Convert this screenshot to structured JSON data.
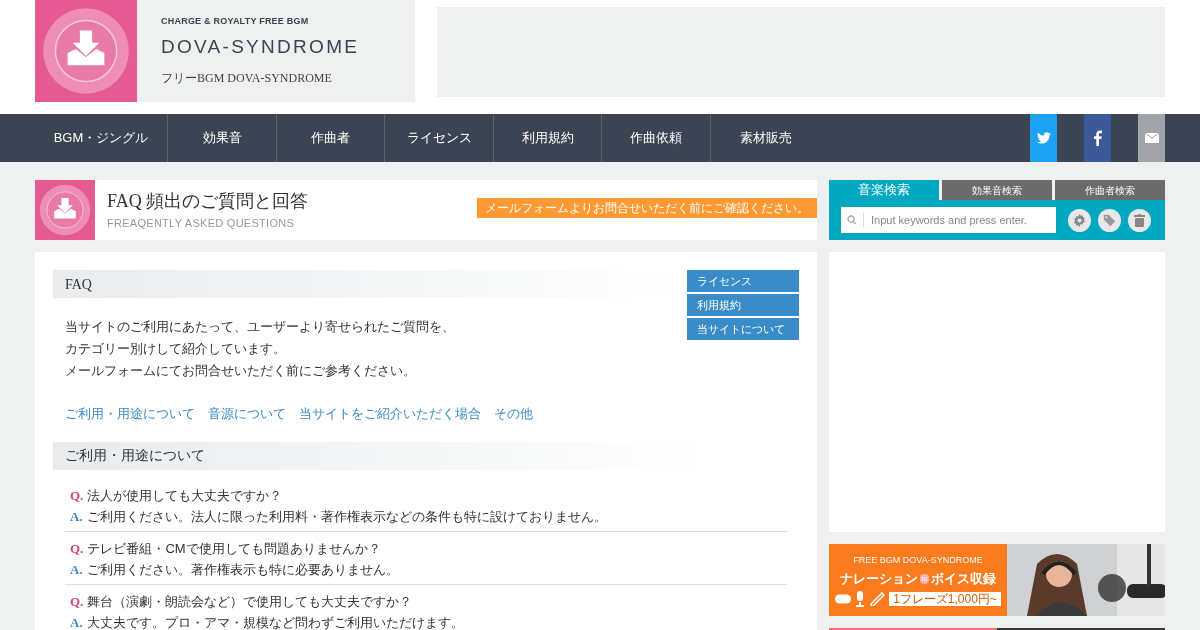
{
  "header": {
    "tagline": "CHARGE & ROYALTY FREE BGM",
    "site_name": "DOVA-SYNDROME",
    "subtitle": "フリーBGM DOVA-SYNDROME"
  },
  "nav": {
    "items": [
      "BGM・ジングル",
      "効果音",
      "作曲者",
      "ライセンス",
      "利用規約",
      "作曲依頼",
      "素材販売"
    ],
    "social": [
      {
        "kind": "twitter",
        "color": "#1da1f2"
      },
      {
        "kind": "facebook",
        "color": "#3b5998"
      },
      {
        "kind": "mail",
        "color": "#a0a3a7"
      }
    ]
  },
  "page_title": {
    "title": "FAQ 頻出のご質問と回答",
    "subtitle": "FREAQENTLY ASKED QUESTIONS",
    "notice": "メールフォームよりお問合せいただく前にご確認ください。"
  },
  "faq": {
    "heading": "FAQ",
    "side_links": [
      "ライセンス",
      "利用規約",
      "当サイトについて"
    ],
    "intro": [
      "当サイトのご利用にあたって、ユーザーより寄せられたご質問を、",
      "カテゴリー別けして紹介しています。",
      "メールフォームにてお問合せいただく前にご参考ください。"
    ],
    "category_links": [
      "ご利用・用途について",
      "音源について",
      "当サイトをご紹介いただく場合",
      "その他"
    ],
    "section_heading": "ご利用・用途について",
    "items": [
      {
        "q_mark": "Q.",
        "question": "法人が使用しても大丈夫ですか？",
        "a_mark": "A.",
        "answer": "ご利用ください。法人に限った利用料・著作権表示などの条件も特に設けておりません。"
      },
      {
        "q_mark": "Q.",
        "question": "テレビ番組・CMで使用しても問題ありませんか？",
        "a_mark": "A.",
        "answer": "ご利用ください。著作権表示も特に必要ありません。"
      },
      {
        "q_mark": "Q.",
        "question": "舞台（演劇・朗読会など）で使用しても大丈夫ですか？",
        "a_mark": "A.",
        "answer": "大丈夫です。プロ・アマ・規模など問わずご利用いただけます。"
      }
    ]
  },
  "search": {
    "tabs": [
      {
        "label": "音楽検索",
        "selected": true
      },
      {
        "label": "効果音検索",
        "selected": false
      },
      {
        "label": "作曲者検索",
        "selected": false
      }
    ],
    "placeholder": "Input keywords and press enter."
  },
  "banner": {
    "brand": "FREE BGM DOVA-SYNDROME",
    "title_left": "ナレーション",
    "joiner": "to",
    "title_right": "ボイス収録",
    "price": "1フレーズ1,000円~"
  }
}
